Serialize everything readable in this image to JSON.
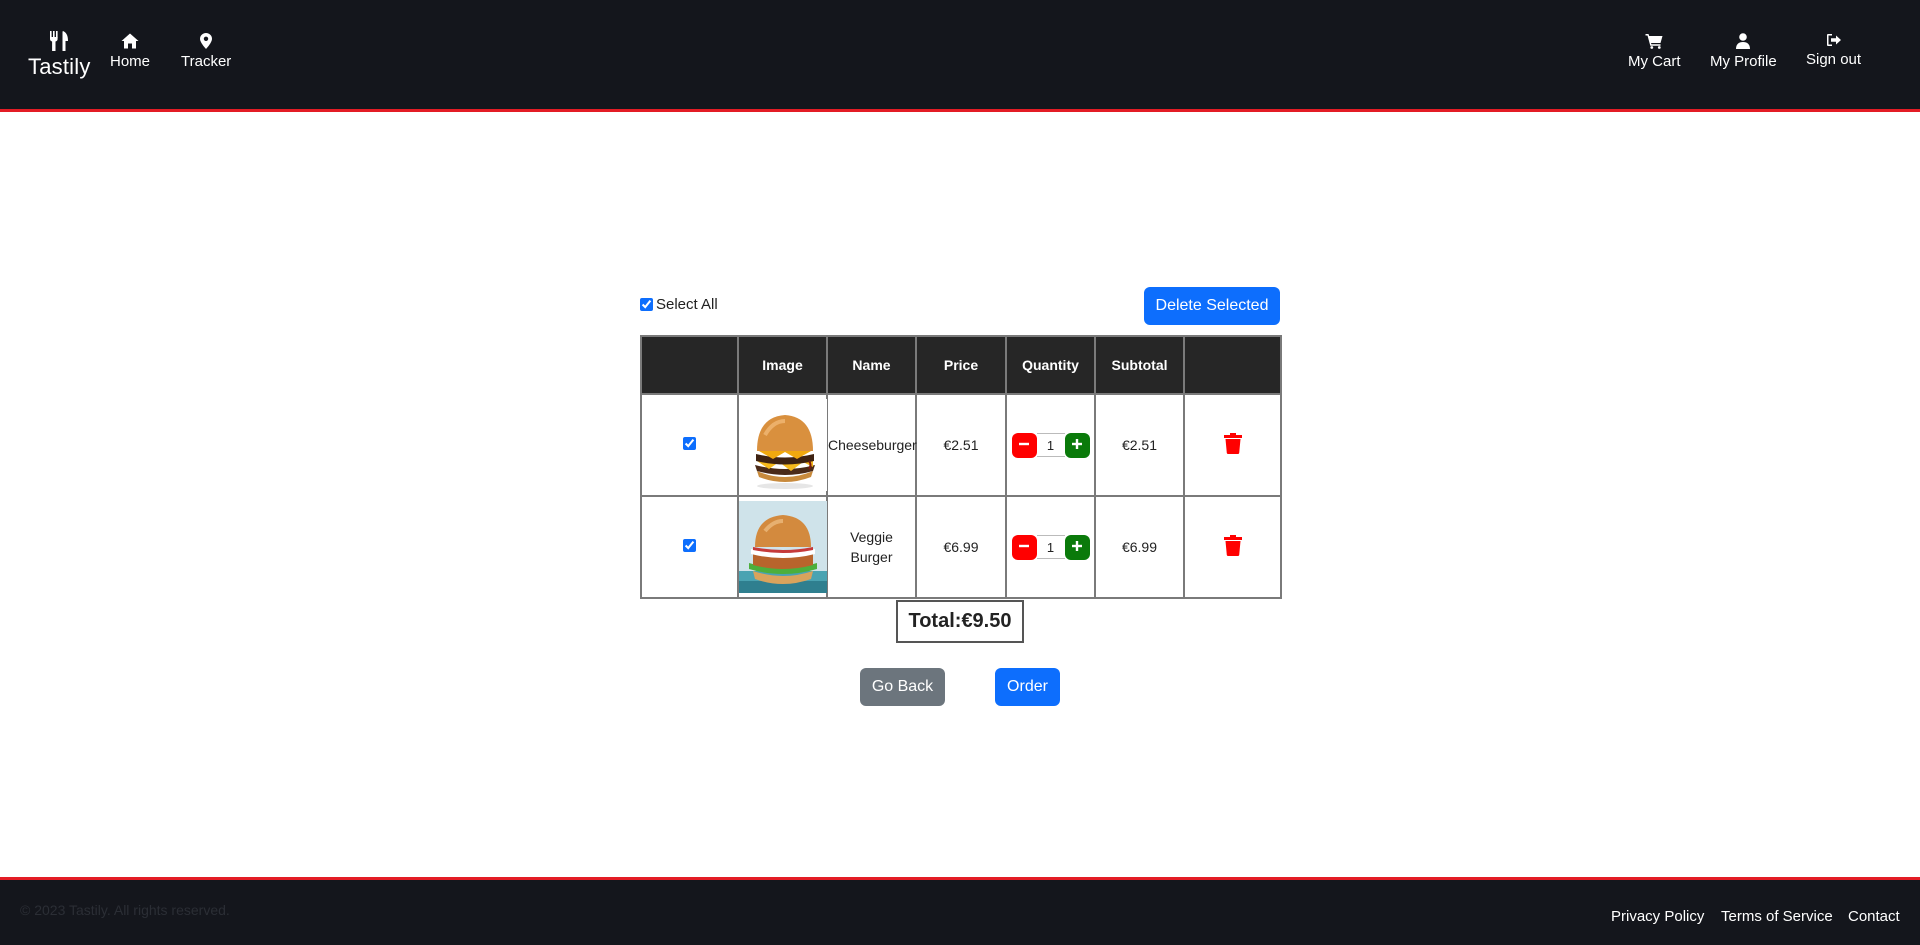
{
  "navbar": {
    "brand": "Tastily",
    "brand_icon": "utensils-icon",
    "left_items": [
      {
        "label": "Home",
        "icon": "home-icon"
      },
      {
        "label": "Tracker",
        "icon": "map-marker-icon"
      }
    ],
    "right_items": [
      {
        "label": "My Cart",
        "icon": "shopping-cart-icon"
      },
      {
        "label": "My Profile",
        "icon": "user-icon"
      },
      {
        "label": "Sign out",
        "icon": "sign-out-icon"
      }
    ],
    "colors": {
      "background": "#14161c",
      "accent": "#e31c25"
    }
  },
  "cart": {
    "select_all_label": "Select All",
    "select_all_checked": true,
    "delete_selected_label": "Delete Selected",
    "columns": [
      "",
      "Image",
      "Name",
      "Price",
      "Quantity",
      "Subtotal",
      ""
    ],
    "items": [
      {
        "checked": true,
        "name": "Cheeseburger",
        "price": "€2.51",
        "quantity": "1",
        "subtotal": "€2.51",
        "image": "cheeseburger-photo"
      },
      {
        "checked": true,
        "name": "Veggie Burger",
        "price": "€6.99",
        "quantity": "1",
        "subtotal": "€6.99",
        "image": "veggie-burger-photo"
      }
    ],
    "total_label": "Total:",
    "total_value": "€9.50",
    "go_back_label": "Go Back",
    "order_label": "Order"
  },
  "footer": {
    "copyright": "© 2023 Tastily. All rights reserved.",
    "links": [
      "Privacy Policy",
      "Terms of Service",
      "Contact"
    ]
  },
  "colors": {
    "primary": "#0d6efd",
    "secondary": "#6c757d",
    "danger": "#ff0000",
    "success": "#0a7a0a"
  }
}
